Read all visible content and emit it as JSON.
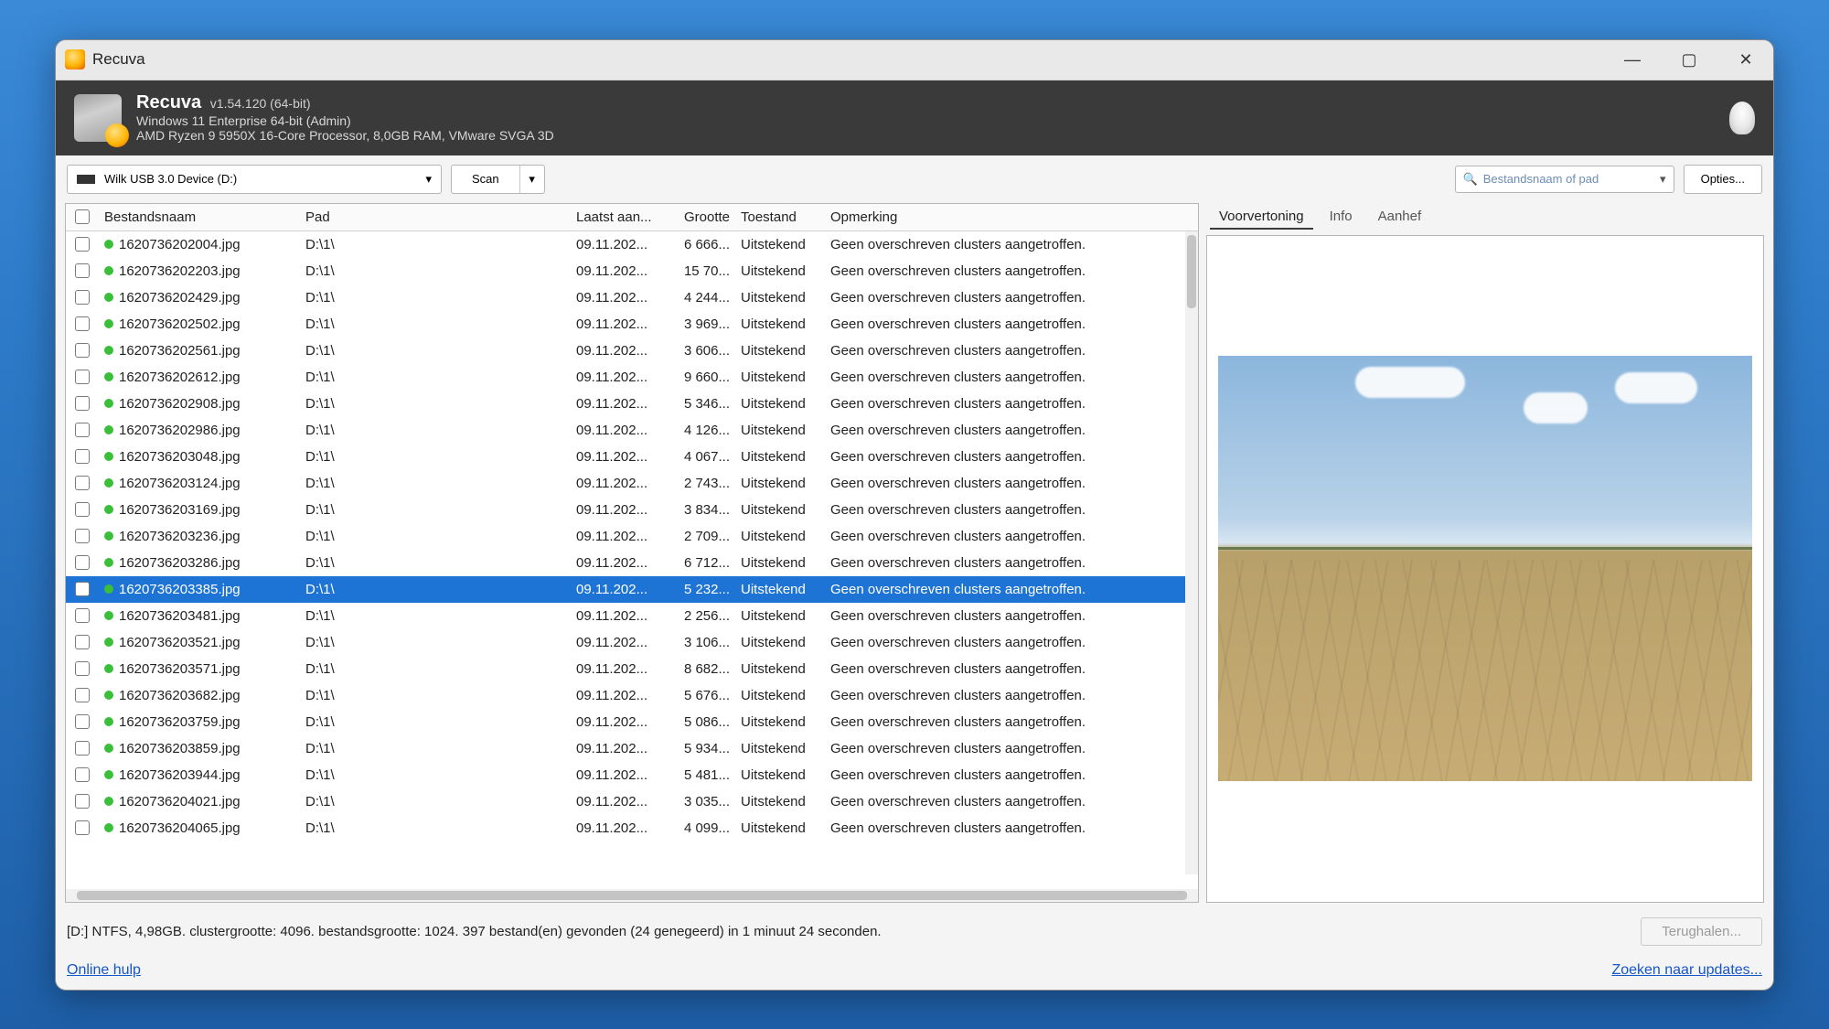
{
  "window": {
    "title": "Recuva"
  },
  "header": {
    "appname": "Recuva",
    "version": "v1.54.120 (64-bit)",
    "os_line": "Windows 11 Enterprise 64-bit (Admin)",
    "hw_line": "AMD Ryzen 9 5950X 16-Core Processor, 8,0GB RAM, VMware SVGA 3D"
  },
  "toolbar": {
    "drive_selected": "Wilk USB 3.0 Device (D:)",
    "scan_label": "Scan",
    "filter_placeholder": "Bestandsnaam of pad",
    "options_label": "Opties..."
  },
  "columns": {
    "name": "Bestandsnaam",
    "path": "Pad",
    "modified": "Laatst aan...",
    "size": "Grootte",
    "state": "Toestand",
    "comment": "Opmerking"
  },
  "common": {
    "date": "09.11.202...",
    "path": "D:\\1\\",
    "state": "Uitstekend",
    "comment": "Geen overschreven clusters aangetroffen."
  },
  "rows": [
    {
      "name": "1620736202004.jpg",
      "size": "6 666...",
      "selected": false
    },
    {
      "name": "1620736202203.jpg",
      "size": "15 70...",
      "selected": false
    },
    {
      "name": "1620736202429.jpg",
      "size": "4 244...",
      "selected": false
    },
    {
      "name": "1620736202502.jpg",
      "size": "3 969...",
      "selected": false
    },
    {
      "name": "1620736202561.jpg",
      "size": "3 606...",
      "selected": false
    },
    {
      "name": "1620736202612.jpg",
      "size": "9 660...",
      "selected": false
    },
    {
      "name": "1620736202908.jpg",
      "size": "5 346...",
      "selected": false
    },
    {
      "name": "1620736202986.jpg",
      "size": "4 126...",
      "selected": false
    },
    {
      "name": "1620736203048.jpg",
      "size": "4 067...",
      "selected": false
    },
    {
      "name": "1620736203124.jpg",
      "size": "2 743...",
      "selected": false
    },
    {
      "name": "1620736203169.jpg",
      "size": "3 834...",
      "selected": false
    },
    {
      "name": "1620736203236.jpg",
      "size": "2 709...",
      "selected": false
    },
    {
      "name": "1620736203286.jpg",
      "size": "6 712...",
      "selected": false
    },
    {
      "name": "1620736203385.jpg",
      "size": "5 232...",
      "selected": true
    },
    {
      "name": "1620736203481.jpg",
      "size": "2 256...",
      "selected": false
    },
    {
      "name": "1620736203521.jpg",
      "size": "3 106...",
      "selected": false
    },
    {
      "name": "1620736203571.jpg",
      "size": "8 682...",
      "selected": false
    },
    {
      "name": "1620736203682.jpg",
      "size": "5 676...",
      "selected": false
    },
    {
      "name": "1620736203759.jpg",
      "size": "5 086...",
      "selected": false
    },
    {
      "name": "1620736203859.jpg",
      "size": "5 934...",
      "selected": false
    },
    {
      "name": "1620736203944.jpg",
      "size": "5 481...",
      "selected": false
    },
    {
      "name": "1620736204021.jpg",
      "size": "3 035...",
      "selected": false
    },
    {
      "name": "1620736204065.jpg",
      "size": "4 099...",
      "selected": false
    }
  ],
  "tabs": {
    "preview": "Voorvertoning",
    "info": "Info",
    "header": "Aanhef",
    "active": "preview"
  },
  "status": {
    "text": "[D:] NTFS, 4,98GB. clustergrootte: 4096. bestandsgrootte: 1024. 397 bestand(en) gevonden (24 genegeerd) in 1 minuut 24 seconden.",
    "recover_label": "Terughalen..."
  },
  "footer": {
    "help": "Online hulp",
    "updates": "Zoeken naar updates..."
  }
}
